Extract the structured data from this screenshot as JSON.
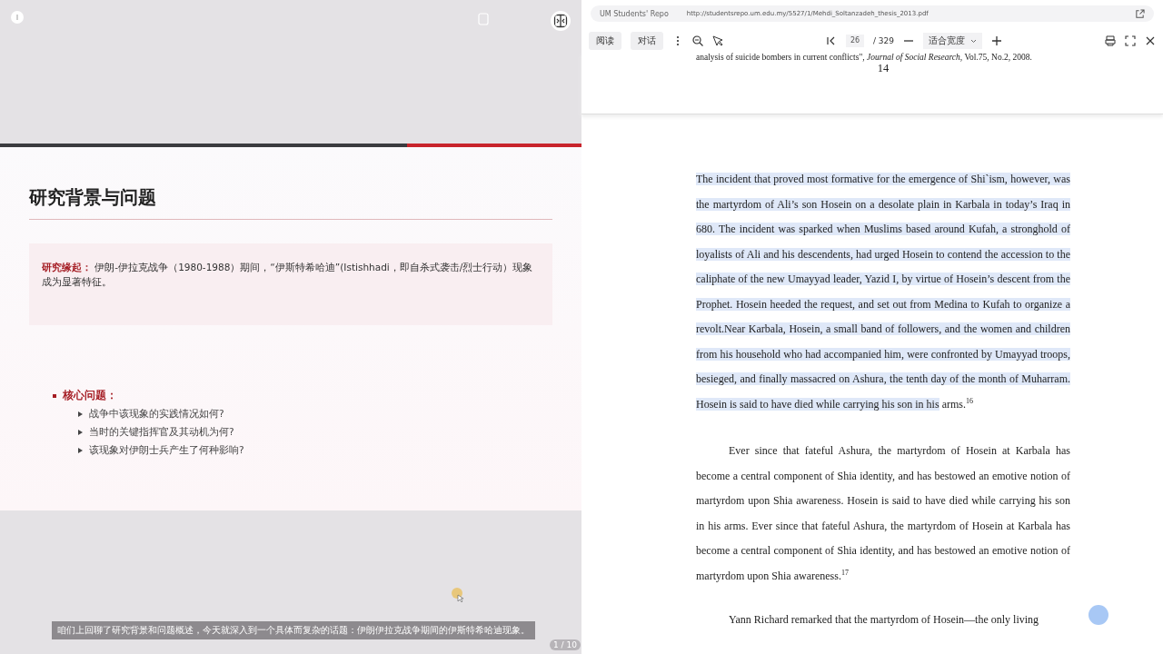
{
  "slide": {
    "title": "研究背景与问题",
    "callout": {
      "label": "研究缘起：",
      "text": "伊朗-伊拉克战争（1980-1988）期间，“伊斯特希哈迪”(Istishhadi，即自杀式袭击/烈士行动）现象成为显著特征。"
    },
    "core": {
      "label": "核心问题：",
      "items": [
        "战争中该现象的实践情况如何?",
        "当时的关键指挥官及其动机为何?",
        "该现象对伊朗士兵产生了何种影响?"
      ]
    }
  },
  "subtitle": "咱们上回聊了研究背景和问题概述，今天就深入到一个具体而复杂的话题：伊朗伊拉克战争期间的伊斯特希哈迪现象。",
  "slide_counter": "1 / 10",
  "browser": {
    "tab": "UM Students' Repo",
    "url": "http://studentsrepo.um.edu.my/5527/1/Mehdi_Soltanzadeh_thesis_2013.pdf"
  },
  "pdf_toolbar": {
    "modes": [
      {
        "label": "阅读"
      },
      {
        "label": "对话"
      }
    ],
    "page": "26",
    "total": "/ 329",
    "zoom": "适合宽度"
  },
  "pdf": {
    "footnote": "analysis of suicide bombers in current conflicts\", *Journal of Social Research*, Vol.75, No.2, 2008.",
    "page_number": "14",
    "paragraphs": [
      {
        "highlighted": "The incident that proved most formative for the emergence of Shi`ism, however, was the martyrdom of Ali’s son Hosein on a desolate plain in Karbala in today’s Iraq in 680. The incident was sparked when Muslims based around Kufah, a stronghold of loyalists of Ali and his descendents, had urged Hosein to contend the accession to the caliphate of the new Umayyad leader, Yazid I, by virtue of Hosein’s descent from the Prophet. Hosein heeded the request, and set out from Medina to Kufah to organize a revolt.Near Karbala, Hosein, a small band of followers, and the women and children from his household who had accompanied him, were confronted by Umayyad troops, besieged, and finally massacred on Ashura, the tenth day of the month of Muharram. Hosein is said to have died while carrying his son in his",
        "text": " arms.$^{16}$"
      },
      {
        "text": "Ever since that fateful Ashura, the martyrdom of Hosein at Karbala has become a central component of Shia identity, and has bestowed an emotive notion of martyrdom upon Shia awareness. Hosein is said to have died while carrying his son in his arms. Ever since that fateful Ashura, the martyrdom of Hosein at Karbala has become a central component of Shia identity, and has bestowed an emotive notion of martyrdom upon Shia awareness.$^{17}$"
      },
      {
        "text": "Yann Richard remarked that the martyrdom of Hosein—the only living"
      }
    ]
  }
}
